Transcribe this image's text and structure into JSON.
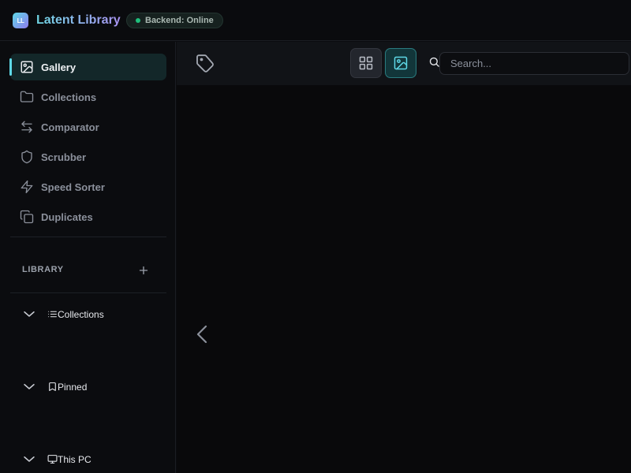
{
  "header": {
    "logo_text": "LL",
    "app_title": "Latent Library",
    "status": "Backend: Online",
    "status_color": "#1fbf7c"
  },
  "sidebar": {
    "nav": [
      {
        "label": "Gallery",
        "icon": "image-icon",
        "active": true
      },
      {
        "label": "Collections",
        "icon": "folder-icon",
        "active": false
      },
      {
        "label": "Comparator",
        "icon": "arrows-left-right-icon",
        "active": false
      },
      {
        "label": "Scrubber",
        "icon": "shield-icon",
        "active": false
      },
      {
        "label": "Speed Sorter",
        "icon": "lightning-icon",
        "active": false
      },
      {
        "label": "Duplicates",
        "icon": "copy-icon",
        "active": false
      }
    ],
    "library_heading": "LIBRARY",
    "tree": [
      {
        "label": "Collections",
        "icon": "list-icon"
      },
      {
        "label": "Pinned",
        "icon": "bookmark-icon"
      },
      {
        "label": "This PC",
        "icon": "monitor-icon"
      }
    ]
  },
  "toolbar": {
    "search_placeholder": "Search...",
    "search_value": "",
    "view_mode": "image"
  },
  "colors": {
    "accent": "#5ed8e6",
    "accent_secondary": "#a993f2",
    "background": "#0b0c0f"
  }
}
